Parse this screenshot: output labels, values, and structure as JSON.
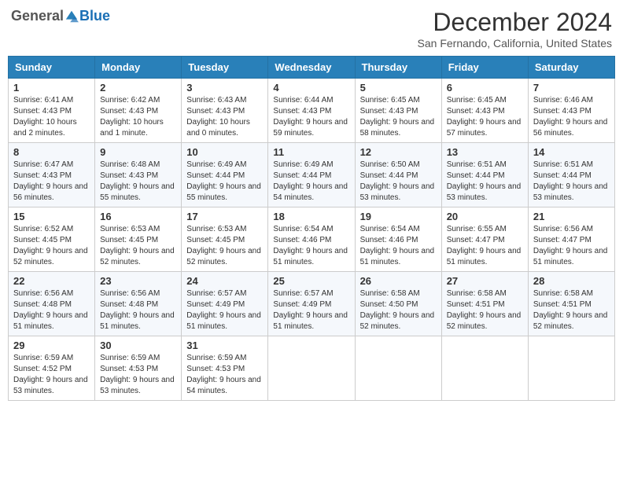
{
  "header": {
    "logo_general": "General",
    "logo_blue": "Blue",
    "month_title": "December 2024",
    "location": "San Fernando, California, United States"
  },
  "weekdays": [
    "Sunday",
    "Monday",
    "Tuesday",
    "Wednesday",
    "Thursday",
    "Friday",
    "Saturday"
  ],
  "weeks": [
    [
      {
        "day": "1",
        "sunrise": "Sunrise: 6:41 AM",
        "sunset": "Sunset: 4:43 PM",
        "daylight": "Daylight: 10 hours and 2 minutes."
      },
      {
        "day": "2",
        "sunrise": "Sunrise: 6:42 AM",
        "sunset": "Sunset: 4:43 PM",
        "daylight": "Daylight: 10 hours and 1 minute."
      },
      {
        "day": "3",
        "sunrise": "Sunrise: 6:43 AM",
        "sunset": "Sunset: 4:43 PM",
        "daylight": "Daylight: 10 hours and 0 minutes."
      },
      {
        "day": "4",
        "sunrise": "Sunrise: 6:44 AM",
        "sunset": "Sunset: 4:43 PM",
        "daylight": "Daylight: 9 hours and 59 minutes."
      },
      {
        "day": "5",
        "sunrise": "Sunrise: 6:45 AM",
        "sunset": "Sunset: 4:43 PM",
        "daylight": "Daylight: 9 hours and 58 minutes."
      },
      {
        "day": "6",
        "sunrise": "Sunrise: 6:45 AM",
        "sunset": "Sunset: 4:43 PM",
        "daylight": "Daylight: 9 hours and 57 minutes."
      },
      {
        "day": "7",
        "sunrise": "Sunrise: 6:46 AM",
        "sunset": "Sunset: 4:43 PM",
        "daylight": "Daylight: 9 hours and 56 minutes."
      }
    ],
    [
      {
        "day": "8",
        "sunrise": "Sunrise: 6:47 AM",
        "sunset": "Sunset: 4:43 PM",
        "daylight": "Daylight: 9 hours and 56 minutes."
      },
      {
        "day": "9",
        "sunrise": "Sunrise: 6:48 AM",
        "sunset": "Sunset: 4:43 PM",
        "daylight": "Daylight: 9 hours and 55 minutes."
      },
      {
        "day": "10",
        "sunrise": "Sunrise: 6:49 AM",
        "sunset": "Sunset: 4:44 PM",
        "daylight": "Daylight: 9 hours and 55 minutes."
      },
      {
        "day": "11",
        "sunrise": "Sunrise: 6:49 AM",
        "sunset": "Sunset: 4:44 PM",
        "daylight": "Daylight: 9 hours and 54 minutes."
      },
      {
        "day": "12",
        "sunrise": "Sunrise: 6:50 AM",
        "sunset": "Sunset: 4:44 PM",
        "daylight": "Daylight: 9 hours and 53 minutes."
      },
      {
        "day": "13",
        "sunrise": "Sunrise: 6:51 AM",
        "sunset": "Sunset: 4:44 PM",
        "daylight": "Daylight: 9 hours and 53 minutes."
      },
      {
        "day": "14",
        "sunrise": "Sunrise: 6:51 AM",
        "sunset": "Sunset: 4:44 PM",
        "daylight": "Daylight: 9 hours and 53 minutes."
      }
    ],
    [
      {
        "day": "15",
        "sunrise": "Sunrise: 6:52 AM",
        "sunset": "Sunset: 4:45 PM",
        "daylight": "Daylight: 9 hours and 52 minutes."
      },
      {
        "day": "16",
        "sunrise": "Sunrise: 6:53 AM",
        "sunset": "Sunset: 4:45 PM",
        "daylight": "Daylight: 9 hours and 52 minutes."
      },
      {
        "day": "17",
        "sunrise": "Sunrise: 6:53 AM",
        "sunset": "Sunset: 4:45 PM",
        "daylight": "Daylight: 9 hours and 52 minutes."
      },
      {
        "day": "18",
        "sunrise": "Sunrise: 6:54 AM",
        "sunset": "Sunset: 4:46 PM",
        "daylight": "Daylight: 9 hours and 51 minutes."
      },
      {
        "day": "19",
        "sunrise": "Sunrise: 6:54 AM",
        "sunset": "Sunset: 4:46 PM",
        "daylight": "Daylight: 9 hours and 51 minutes."
      },
      {
        "day": "20",
        "sunrise": "Sunrise: 6:55 AM",
        "sunset": "Sunset: 4:47 PM",
        "daylight": "Daylight: 9 hours and 51 minutes."
      },
      {
        "day": "21",
        "sunrise": "Sunrise: 6:56 AM",
        "sunset": "Sunset: 4:47 PM",
        "daylight": "Daylight: 9 hours and 51 minutes."
      }
    ],
    [
      {
        "day": "22",
        "sunrise": "Sunrise: 6:56 AM",
        "sunset": "Sunset: 4:48 PM",
        "daylight": "Daylight: 9 hours and 51 minutes."
      },
      {
        "day": "23",
        "sunrise": "Sunrise: 6:56 AM",
        "sunset": "Sunset: 4:48 PM",
        "daylight": "Daylight: 9 hours and 51 minutes."
      },
      {
        "day": "24",
        "sunrise": "Sunrise: 6:57 AM",
        "sunset": "Sunset: 4:49 PM",
        "daylight": "Daylight: 9 hours and 51 minutes."
      },
      {
        "day": "25",
        "sunrise": "Sunrise: 6:57 AM",
        "sunset": "Sunset: 4:49 PM",
        "daylight": "Daylight: 9 hours and 51 minutes."
      },
      {
        "day": "26",
        "sunrise": "Sunrise: 6:58 AM",
        "sunset": "Sunset: 4:50 PM",
        "daylight": "Daylight: 9 hours and 52 minutes."
      },
      {
        "day": "27",
        "sunrise": "Sunrise: 6:58 AM",
        "sunset": "Sunset: 4:51 PM",
        "daylight": "Daylight: 9 hours and 52 minutes."
      },
      {
        "day": "28",
        "sunrise": "Sunrise: 6:58 AM",
        "sunset": "Sunset: 4:51 PM",
        "daylight": "Daylight: 9 hours and 52 minutes."
      }
    ],
    [
      {
        "day": "29",
        "sunrise": "Sunrise: 6:59 AM",
        "sunset": "Sunset: 4:52 PM",
        "daylight": "Daylight: 9 hours and 53 minutes."
      },
      {
        "day": "30",
        "sunrise": "Sunrise: 6:59 AM",
        "sunset": "Sunset: 4:53 PM",
        "daylight": "Daylight: 9 hours and 53 minutes."
      },
      {
        "day": "31",
        "sunrise": "Sunrise: 6:59 AM",
        "sunset": "Sunset: 4:53 PM",
        "daylight": "Daylight: 9 hours and 54 minutes."
      },
      null,
      null,
      null,
      null
    ]
  ]
}
